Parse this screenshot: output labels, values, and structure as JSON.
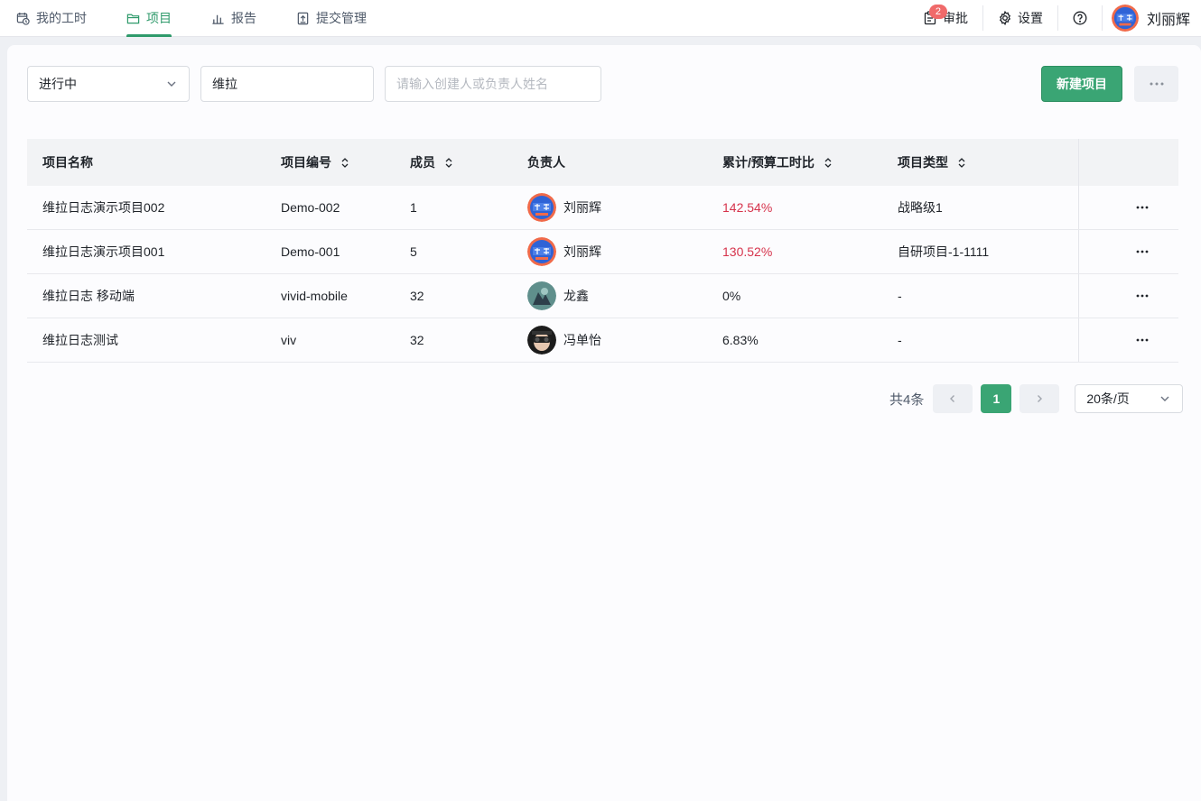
{
  "nav": [
    {
      "label": "我的工时",
      "icon": "clock-calendar-icon",
      "active": false
    },
    {
      "label": "项目",
      "icon": "folder-icon",
      "active": true
    },
    {
      "label": "报告",
      "icon": "bar-chart-icon",
      "active": false
    },
    {
      "label": "提交管理",
      "icon": "upload-doc-icon",
      "active": false
    }
  ],
  "topright": {
    "approval_label": "审批",
    "approval_badge": "2",
    "settings_label": "设置",
    "user_name": "刘丽辉"
  },
  "filters": {
    "status_value": "进行中",
    "name_value": "维拉",
    "person_placeholder": "请输入创建人或负责人姓名"
  },
  "actions": {
    "new_project_label": "新建项目"
  },
  "table": {
    "headers": {
      "name": "项目名称",
      "code": "项目编号",
      "members": "成员",
      "owner": "负责人",
      "ratio": "累计/预算工时比",
      "type": "项目类型"
    },
    "rows": [
      {
        "name": "维拉日志演示项目002",
        "code": "Demo-002",
        "members": "1",
        "owner": "刘丽辉",
        "ratio": "142.54%",
        "over": true,
        "type": "战略级1",
        "avatar": "lihui"
      },
      {
        "name": "维拉日志演示项目001",
        "code": "Demo-001",
        "members": "5",
        "owner": "刘丽辉",
        "ratio": "130.52%",
        "over": true,
        "type": "自研项目-1-1111",
        "avatar": "lihui"
      },
      {
        "name": "维拉日志 移动端",
        "code": "vivid-mobile",
        "members": "32",
        "owner": "龙鑫",
        "ratio": "0%",
        "over": false,
        "type": "-",
        "avatar": "teal"
      },
      {
        "name": "维拉日志测试",
        "code": "viv",
        "members": "32",
        "owner": "冯单怡",
        "ratio": "6.83%",
        "over": false,
        "type": "-",
        "avatar": "dark"
      }
    ]
  },
  "pagination": {
    "total_label": "共4条",
    "current_page": "1",
    "page_size": "20条/页"
  },
  "colors": {
    "primary": "#3aa574",
    "over_budget": "#d6334c",
    "badge": "#f06a6a"
  }
}
